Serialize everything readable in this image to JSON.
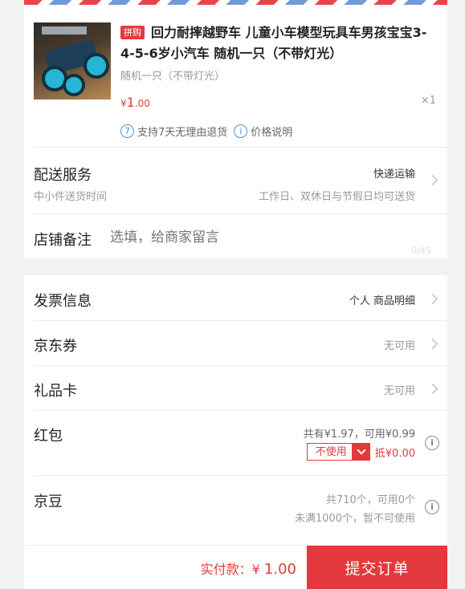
{
  "product": {
    "tag": "拼购",
    "title": "回力耐摔越野车 儿童小车模型玩具车男孩宝宝3-4-5-6岁小汽车 随机一只（不带灯光）",
    "spec": "随机一只（不带灯光）",
    "price_symbol": "¥",
    "price_int": "1",
    "price_dec": ".00",
    "qty": "×1",
    "service_num": "7",
    "service_text": "支持7天无理由退货",
    "price_info_icon": "i",
    "price_info_text": "价格说明"
  },
  "delivery": {
    "label": "配送服务",
    "method": "快递运输",
    "sub_left": "中小件送货时间",
    "sub_right": "工作日、双休日与节假日均可送货"
  },
  "note": {
    "label": "店铺备注",
    "placeholder": "选填，给商家留言",
    "counter": "0/45"
  },
  "invoice": {
    "label": "发票信息",
    "value": "个人 商品明细"
  },
  "coupon": {
    "label": "京东券",
    "value": "无可用"
  },
  "giftcard": {
    "label": "礼品卡",
    "value": "无可用"
  },
  "redpacket": {
    "label": "红包",
    "summary": "共有¥1.97，可用¥0.99",
    "button": "不使用",
    "deduct": "抵¥0.00"
  },
  "jingdou": {
    "label": "京豆",
    "line1": "共710个，可用0个",
    "line2": "未满1000个，暂不可使用"
  },
  "footer": {
    "total_label": "实付款：",
    "total_symbol": "¥",
    "total_value": "1.00",
    "submit": "提交订单"
  },
  "colors": {
    "accent": "#e4393c",
    "link_blue": "#4a90d9"
  }
}
